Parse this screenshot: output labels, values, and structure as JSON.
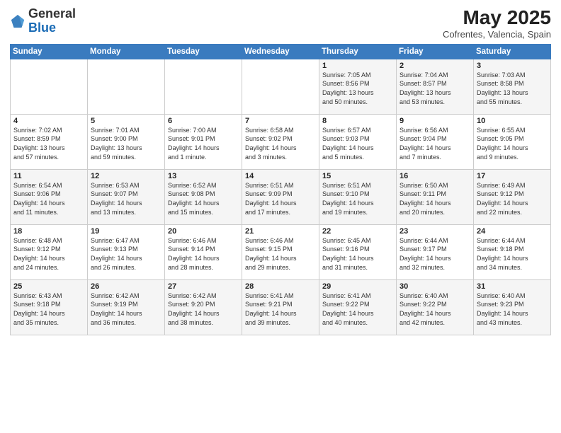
{
  "header": {
    "logo_general": "General",
    "logo_blue": "Blue",
    "month_year": "May 2025",
    "location": "Cofrentes, Valencia, Spain"
  },
  "days_of_week": [
    "Sunday",
    "Monday",
    "Tuesday",
    "Wednesday",
    "Thursday",
    "Friday",
    "Saturday"
  ],
  "weeks": [
    [
      {
        "num": "",
        "info": ""
      },
      {
        "num": "",
        "info": ""
      },
      {
        "num": "",
        "info": ""
      },
      {
        "num": "",
        "info": ""
      },
      {
        "num": "1",
        "info": "Sunrise: 7:05 AM\nSunset: 8:56 PM\nDaylight: 13 hours\nand 50 minutes."
      },
      {
        "num": "2",
        "info": "Sunrise: 7:04 AM\nSunset: 8:57 PM\nDaylight: 13 hours\nand 53 minutes."
      },
      {
        "num": "3",
        "info": "Sunrise: 7:03 AM\nSunset: 8:58 PM\nDaylight: 13 hours\nand 55 minutes."
      }
    ],
    [
      {
        "num": "4",
        "info": "Sunrise: 7:02 AM\nSunset: 8:59 PM\nDaylight: 13 hours\nand 57 minutes."
      },
      {
        "num": "5",
        "info": "Sunrise: 7:01 AM\nSunset: 9:00 PM\nDaylight: 13 hours\nand 59 minutes."
      },
      {
        "num": "6",
        "info": "Sunrise: 7:00 AM\nSunset: 9:01 PM\nDaylight: 14 hours\nand 1 minute."
      },
      {
        "num": "7",
        "info": "Sunrise: 6:58 AM\nSunset: 9:02 PM\nDaylight: 14 hours\nand 3 minutes."
      },
      {
        "num": "8",
        "info": "Sunrise: 6:57 AM\nSunset: 9:03 PM\nDaylight: 14 hours\nand 5 minutes."
      },
      {
        "num": "9",
        "info": "Sunrise: 6:56 AM\nSunset: 9:04 PM\nDaylight: 14 hours\nand 7 minutes."
      },
      {
        "num": "10",
        "info": "Sunrise: 6:55 AM\nSunset: 9:05 PM\nDaylight: 14 hours\nand 9 minutes."
      }
    ],
    [
      {
        "num": "11",
        "info": "Sunrise: 6:54 AM\nSunset: 9:06 PM\nDaylight: 14 hours\nand 11 minutes."
      },
      {
        "num": "12",
        "info": "Sunrise: 6:53 AM\nSunset: 9:07 PM\nDaylight: 14 hours\nand 13 minutes."
      },
      {
        "num": "13",
        "info": "Sunrise: 6:52 AM\nSunset: 9:08 PM\nDaylight: 14 hours\nand 15 minutes."
      },
      {
        "num": "14",
        "info": "Sunrise: 6:51 AM\nSunset: 9:09 PM\nDaylight: 14 hours\nand 17 minutes."
      },
      {
        "num": "15",
        "info": "Sunrise: 6:51 AM\nSunset: 9:10 PM\nDaylight: 14 hours\nand 19 minutes."
      },
      {
        "num": "16",
        "info": "Sunrise: 6:50 AM\nSunset: 9:11 PM\nDaylight: 14 hours\nand 20 minutes."
      },
      {
        "num": "17",
        "info": "Sunrise: 6:49 AM\nSunset: 9:12 PM\nDaylight: 14 hours\nand 22 minutes."
      }
    ],
    [
      {
        "num": "18",
        "info": "Sunrise: 6:48 AM\nSunset: 9:12 PM\nDaylight: 14 hours\nand 24 minutes."
      },
      {
        "num": "19",
        "info": "Sunrise: 6:47 AM\nSunset: 9:13 PM\nDaylight: 14 hours\nand 26 minutes."
      },
      {
        "num": "20",
        "info": "Sunrise: 6:46 AM\nSunset: 9:14 PM\nDaylight: 14 hours\nand 28 minutes."
      },
      {
        "num": "21",
        "info": "Sunrise: 6:46 AM\nSunset: 9:15 PM\nDaylight: 14 hours\nand 29 minutes."
      },
      {
        "num": "22",
        "info": "Sunrise: 6:45 AM\nSunset: 9:16 PM\nDaylight: 14 hours\nand 31 minutes."
      },
      {
        "num": "23",
        "info": "Sunrise: 6:44 AM\nSunset: 9:17 PM\nDaylight: 14 hours\nand 32 minutes."
      },
      {
        "num": "24",
        "info": "Sunrise: 6:44 AM\nSunset: 9:18 PM\nDaylight: 14 hours\nand 34 minutes."
      }
    ],
    [
      {
        "num": "25",
        "info": "Sunrise: 6:43 AM\nSunset: 9:18 PM\nDaylight: 14 hours\nand 35 minutes."
      },
      {
        "num": "26",
        "info": "Sunrise: 6:42 AM\nSunset: 9:19 PM\nDaylight: 14 hours\nand 36 minutes."
      },
      {
        "num": "27",
        "info": "Sunrise: 6:42 AM\nSunset: 9:20 PM\nDaylight: 14 hours\nand 38 minutes."
      },
      {
        "num": "28",
        "info": "Sunrise: 6:41 AM\nSunset: 9:21 PM\nDaylight: 14 hours\nand 39 minutes."
      },
      {
        "num": "29",
        "info": "Sunrise: 6:41 AM\nSunset: 9:22 PM\nDaylight: 14 hours\nand 40 minutes."
      },
      {
        "num": "30",
        "info": "Sunrise: 6:40 AM\nSunset: 9:22 PM\nDaylight: 14 hours\nand 42 minutes."
      },
      {
        "num": "31",
        "info": "Sunrise: 6:40 AM\nSunset: 9:23 PM\nDaylight: 14 hours\nand 43 minutes."
      }
    ]
  ]
}
